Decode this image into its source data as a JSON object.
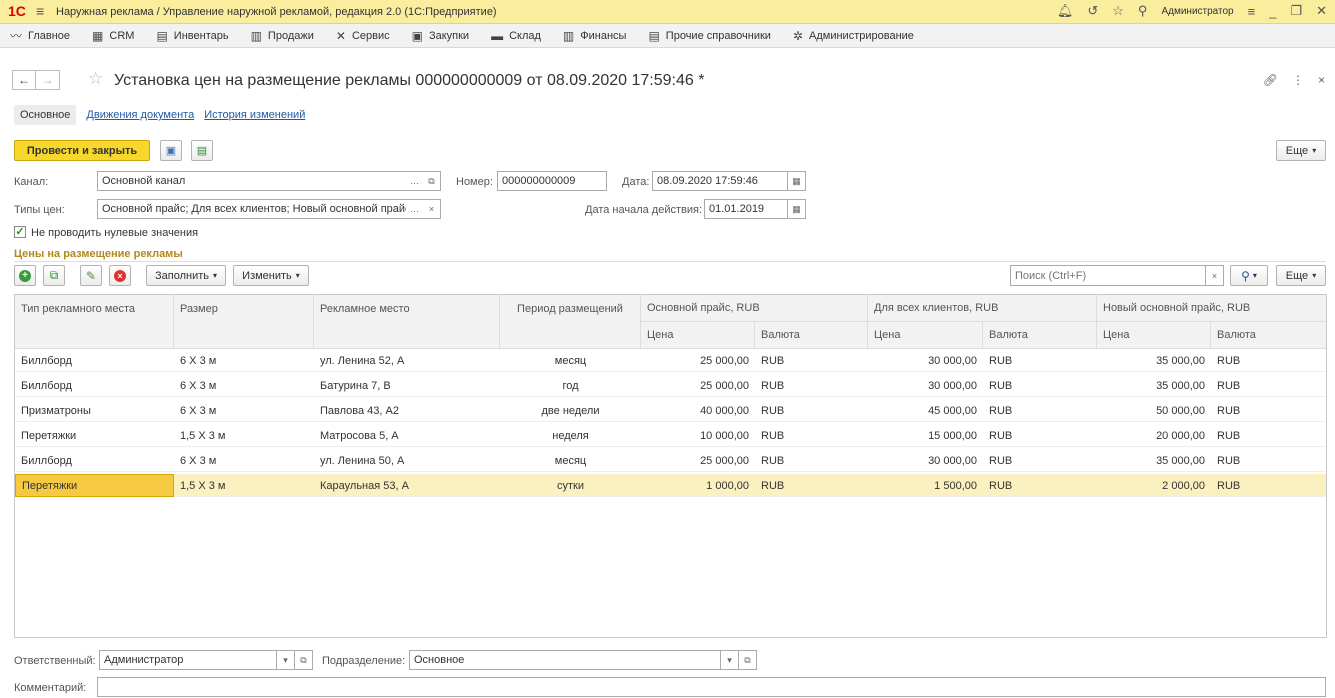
{
  "titlebar": {
    "logo": "1С",
    "title": "Наружная реклама / Управление наружной рекламой, редакция 2.0  (1С:Предприятие)",
    "user": "Администратор"
  },
  "menu": [
    {
      "icon": "chart-line-icon",
      "glyph": "〰",
      "label": "Главное"
    },
    {
      "icon": "crm-icon",
      "glyph": "▦",
      "label": "CRM"
    },
    {
      "icon": "inventory-icon",
      "glyph": "▤",
      "label": "Инвентарь"
    },
    {
      "icon": "sales-icon",
      "glyph": "▥",
      "label": "Продажи"
    },
    {
      "icon": "service-icon",
      "glyph": "✕",
      "label": "Сервис"
    },
    {
      "icon": "purchases-icon",
      "glyph": "▣",
      "label": "Закупки"
    },
    {
      "icon": "warehouse-icon",
      "glyph": "▬",
      "label": "Склад"
    },
    {
      "icon": "finance-icon",
      "glyph": "▥",
      "label": "Финансы"
    },
    {
      "icon": "references-icon",
      "glyph": "▤",
      "label": "Прочие справочники"
    },
    {
      "icon": "admin-gear-icon",
      "glyph": "✲",
      "label": "Администрирование"
    }
  ],
  "document": {
    "title": "Установка цен на размещение рекламы 000000000009 от 08.09.2020 17:59:46 *"
  },
  "tabs": [
    {
      "label": "Основное",
      "active": true
    },
    {
      "label": "Движения документа",
      "active": false
    },
    {
      "label": "История изменений",
      "active": false
    }
  ],
  "toolbar": {
    "post_close": "Провести и закрыть",
    "more": "Еще"
  },
  "form": {
    "channel_label": "Канал:",
    "channel_value": "Основной канал",
    "number_label": "Номер:",
    "number_value": "000000000009",
    "date_label": "Дата:",
    "date_value": "08.09.2020 17:59:46",
    "price_types_label": "Типы цен:",
    "price_types_value": "Основной прайс; Для всех клиентов; Новый основной прайс",
    "start_date_label": "Дата начала действия:",
    "start_date_value": "01.01.2019",
    "checkbox_label": "Не проводить нулевые значения",
    "checkbox_checked": true
  },
  "section": {
    "title": "Цены на размещение рекламы",
    "fill": "Заполнить",
    "change": "Изменить",
    "search_placeholder": "Поиск (Ctrl+F)",
    "more": "Еще"
  },
  "table": {
    "headers": {
      "type": "Тип рекламного места",
      "size": "Размер",
      "place": "Рекламное место",
      "period": "Период размещений",
      "g1": "Основной прайс, RUB",
      "g2": "Для всех клиентов, RUB",
      "g3": "Новый основной прайс, RUB",
      "price": "Цена",
      "currency": "Валюта"
    },
    "rows": [
      {
        "type": "Биллборд",
        "size": "6 X 3 м",
        "place": "ул. Ленина 52, А",
        "period": "месяц",
        "p1": "25 000,00",
        "c1": "RUB",
        "p2": "30 000,00",
        "c2": "RUB",
        "p3": "35 000,00",
        "c3": "RUB"
      },
      {
        "type": "Биллборд",
        "size": "6 X 3 м",
        "place": "Батурина 7, В",
        "period": "год",
        "p1": "25 000,00",
        "c1": "RUB",
        "p2": "30 000,00",
        "c2": "RUB",
        "p3": "35 000,00",
        "c3": "RUB"
      },
      {
        "type": "Призматроны",
        "size": "6 X 3 м",
        "place": "Павлова 43, А2",
        "period": "две недели",
        "p1": "40 000,00",
        "c1": "RUB",
        "p2": "45 000,00",
        "c2": "RUB",
        "p3": "50 000,00",
        "c3": "RUB"
      },
      {
        "type": "Перетяжки",
        "size": "1,5 X 3 м",
        "place": "Матросова 5, А",
        "period": "неделя",
        "p1": "10 000,00",
        "c1": "RUB",
        "p2": "15 000,00",
        "c2": "RUB",
        "p3": "20 000,00",
        "c3": "RUB"
      },
      {
        "type": "Биллборд",
        "size": "6 X 3 м",
        "place": "ул. Ленина 50, А",
        "period": "месяц",
        "p1": "25 000,00",
        "c1": "RUB",
        "p2": "30 000,00",
        "c2": "RUB",
        "p3": "35 000,00",
        "c3": "RUB"
      },
      {
        "type": "Перетяжки",
        "size": "1,5 X 3 м",
        "place": "Караульная 53, А",
        "period": "сутки",
        "p1": "1 000,00",
        "c1": "RUB",
        "p2": "1 500,00",
        "c2": "RUB",
        "p3": "2 000,00",
        "c3": "RUB"
      }
    ],
    "selected_row": 5
  },
  "footer": {
    "responsible_label": "Ответственный:",
    "responsible_value": "Администратор",
    "department_label": "Подразделение:",
    "department_value": "Основное",
    "comment_label": "Комментарий:",
    "comment_value": ""
  }
}
